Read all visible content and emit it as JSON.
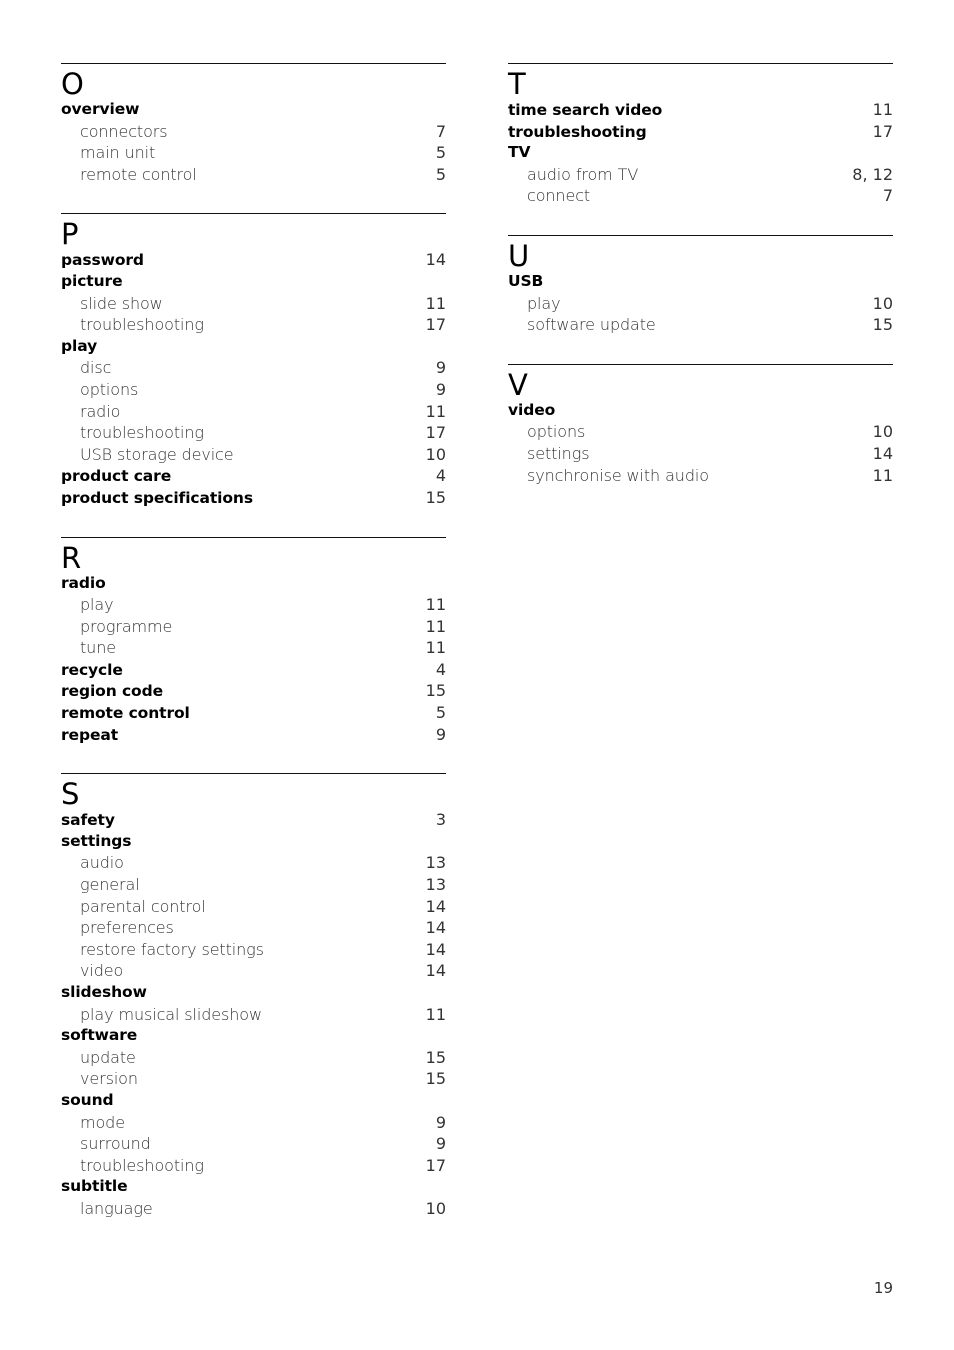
{
  "columns": [
    {
      "sections": [
        {
          "letter": "O",
          "entries": [
            {
              "term": "overview",
              "level": "main",
              "page": ""
            },
            {
              "term": "connectors",
              "level": "sub",
              "page": "7"
            },
            {
              "term": "main unit",
              "level": "sub",
              "page": "5"
            },
            {
              "term": "remote control",
              "level": "sub",
              "page": "5"
            }
          ]
        },
        {
          "letter": "P",
          "entries": [
            {
              "term": "password",
              "level": "main",
              "page": "14"
            },
            {
              "term": "picture",
              "level": "main",
              "page": ""
            },
            {
              "term": "slide show",
              "level": "sub",
              "page": "11"
            },
            {
              "term": "troubleshooting",
              "level": "sub",
              "page": "17"
            },
            {
              "term": "play",
              "level": "main",
              "page": ""
            },
            {
              "term": "disc",
              "level": "sub",
              "page": "9"
            },
            {
              "term": "options",
              "level": "sub",
              "page": "9"
            },
            {
              "term": "radio",
              "level": "sub",
              "page": "11"
            },
            {
              "term": "troubleshooting",
              "level": "sub",
              "page": "17"
            },
            {
              "term": "USB storage device",
              "level": "sub",
              "page": "10"
            },
            {
              "term": "product care",
              "level": "main",
              "page": "4"
            },
            {
              "term": "product specifications",
              "level": "main",
              "page": "15"
            }
          ]
        },
        {
          "letter": "R",
          "entries": [
            {
              "term": "radio",
              "level": "main",
              "page": ""
            },
            {
              "term": "play",
              "level": "sub",
              "page": "11"
            },
            {
              "term": "programme",
              "level": "sub",
              "page": "11"
            },
            {
              "term": "tune",
              "level": "sub",
              "page": "11"
            },
            {
              "term": "recycle",
              "level": "main",
              "page": "4"
            },
            {
              "term": "region code",
              "level": "main",
              "page": "15"
            },
            {
              "term": "remote control",
              "level": "main",
              "page": "5"
            },
            {
              "term": "repeat",
              "level": "main",
              "page": "9"
            }
          ]
        },
        {
          "letter": "S",
          "entries": [
            {
              "term": "safety",
              "level": "main",
              "page": "3"
            },
            {
              "term": "settings",
              "level": "main",
              "page": ""
            },
            {
              "term": "audio",
              "level": "sub",
              "page": "13"
            },
            {
              "term": "general",
              "level": "sub",
              "page": "13"
            },
            {
              "term": "parental control",
              "level": "sub",
              "page": "14"
            },
            {
              "term": "preferences",
              "level": "sub",
              "page": "14"
            },
            {
              "term": "restore factory settings",
              "level": "sub",
              "page": "14"
            },
            {
              "term": "video",
              "level": "sub",
              "page": "14"
            },
            {
              "term": "slideshow",
              "level": "main",
              "page": ""
            },
            {
              "term": "play musical slideshow",
              "level": "sub",
              "page": "11"
            },
            {
              "term": "software",
              "level": "main",
              "page": ""
            },
            {
              "term": "update",
              "level": "sub",
              "page": "15"
            },
            {
              "term": "version",
              "level": "sub",
              "page": "15"
            },
            {
              "term": "sound",
              "level": "main",
              "page": ""
            },
            {
              "term": "mode",
              "level": "sub",
              "page": "9"
            },
            {
              "term": "surround",
              "level": "sub",
              "page": "9"
            },
            {
              "term": "troubleshooting",
              "level": "sub",
              "page": "17"
            },
            {
              "term": "subtitle",
              "level": "main",
              "page": ""
            },
            {
              "term": "language",
              "level": "sub",
              "page": "10"
            }
          ]
        }
      ]
    },
    {
      "sections": [
        {
          "letter": "T",
          "entries": [
            {
              "term": "time search video",
              "level": "main",
              "page": "11"
            },
            {
              "term": "troubleshooting",
              "level": "main",
              "page": "17"
            },
            {
              "term": "TV",
              "level": "main",
              "page": ""
            },
            {
              "term": "audio from TV",
              "level": "sub",
              "page": "8, 12"
            },
            {
              "term": "connect",
              "level": "sub",
              "page": "7"
            }
          ]
        },
        {
          "letter": "U",
          "entries": [
            {
              "term": "USB",
              "level": "main",
              "page": ""
            },
            {
              "term": "play",
              "level": "sub",
              "page": "10"
            },
            {
              "term": "software update",
              "level": "sub",
              "page": "15"
            }
          ]
        },
        {
          "letter": "V",
          "entries": [
            {
              "term": "video",
              "level": "main",
              "page": ""
            },
            {
              "term": "options",
              "level": "sub",
              "page": "10"
            },
            {
              "term": "settings",
              "level": "sub",
              "page": "14"
            },
            {
              "term": "synchronise with audio",
              "level": "sub",
              "page": "11"
            }
          ]
        }
      ]
    }
  ],
  "footer": {
    "page_number": "19"
  }
}
